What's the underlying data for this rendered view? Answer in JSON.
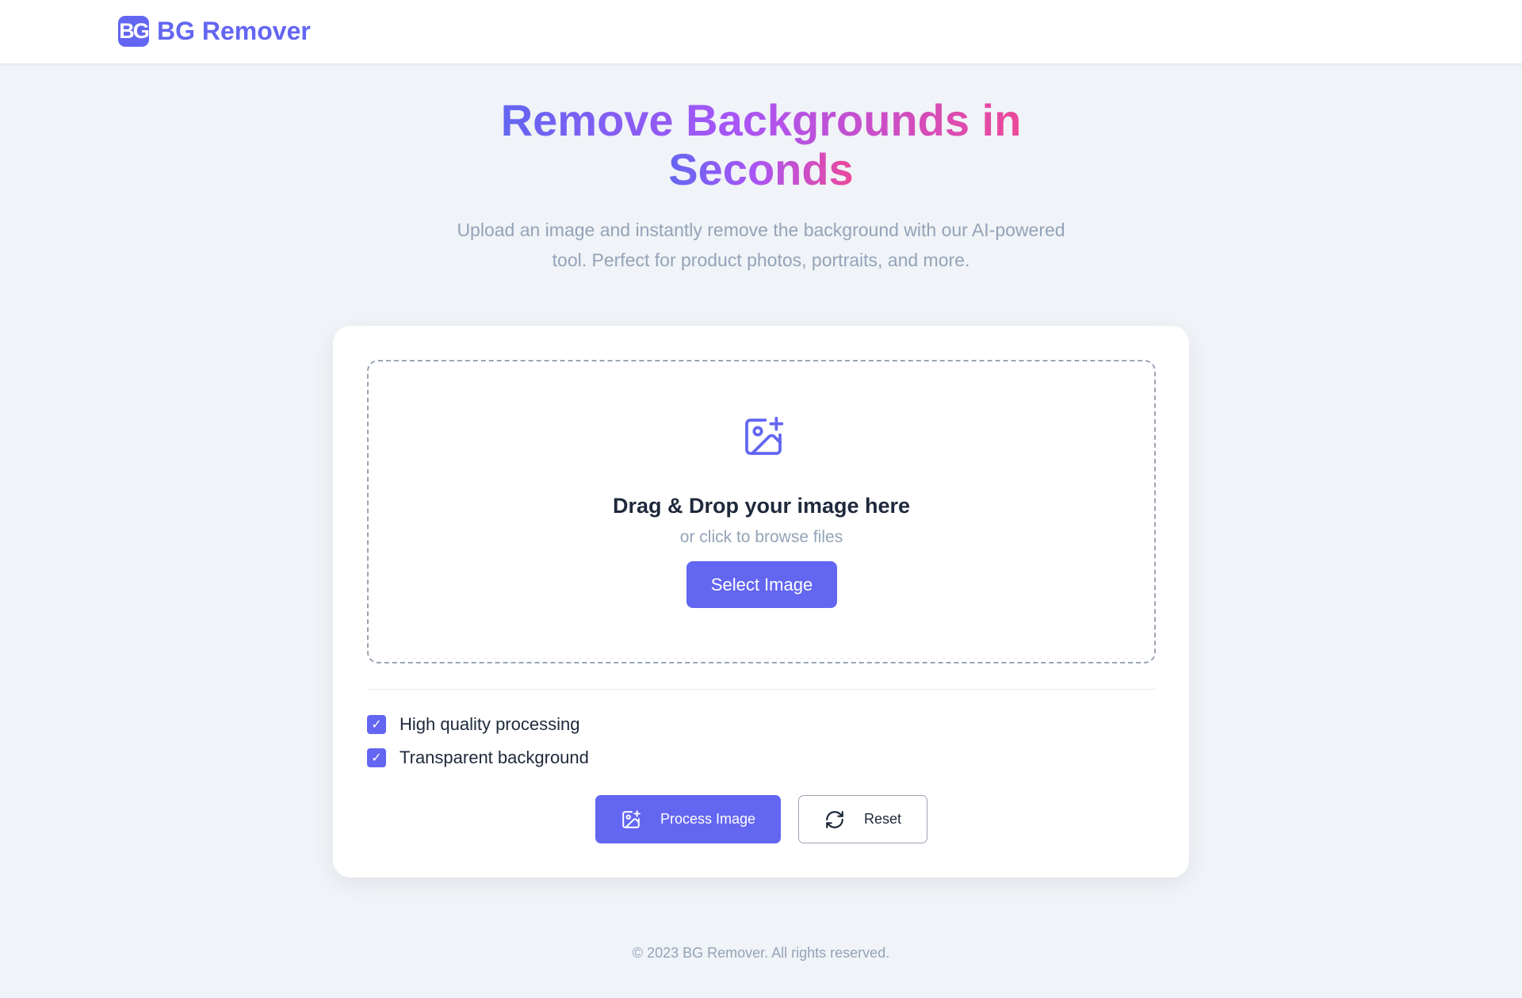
{
  "header": {
    "logo_text": "BG",
    "brand_name": "BG Remover"
  },
  "hero": {
    "title_line1": "Remove Backgrounds in",
    "title_line2": "Seconds",
    "subtitle_line1": "Upload an image and instantly remove the background with our AI-powered",
    "subtitle_line2": "tool. Perfect for product photos, portraits, and more."
  },
  "upload": {
    "icon": "image-plus-icon",
    "title": "Drag & Drop your image here",
    "hint": "or click to browse files",
    "button_label": "Select Image"
  },
  "options": [
    {
      "label": "High quality processing",
      "checked": true
    },
    {
      "label": "Transparent background",
      "checked": true
    }
  ],
  "actions": {
    "process_label": "Process Image",
    "process_icon": "image-plus-icon",
    "reset_label": "Reset",
    "reset_icon": "refresh-icon"
  },
  "footer": {
    "text": "© 2023 BG Remover. All rights reserved."
  },
  "colors": {
    "accent": "#6366f1",
    "gradient_start": "#6366f1",
    "gradient_end": "#ec4899",
    "background": "#f0f3f7"
  }
}
